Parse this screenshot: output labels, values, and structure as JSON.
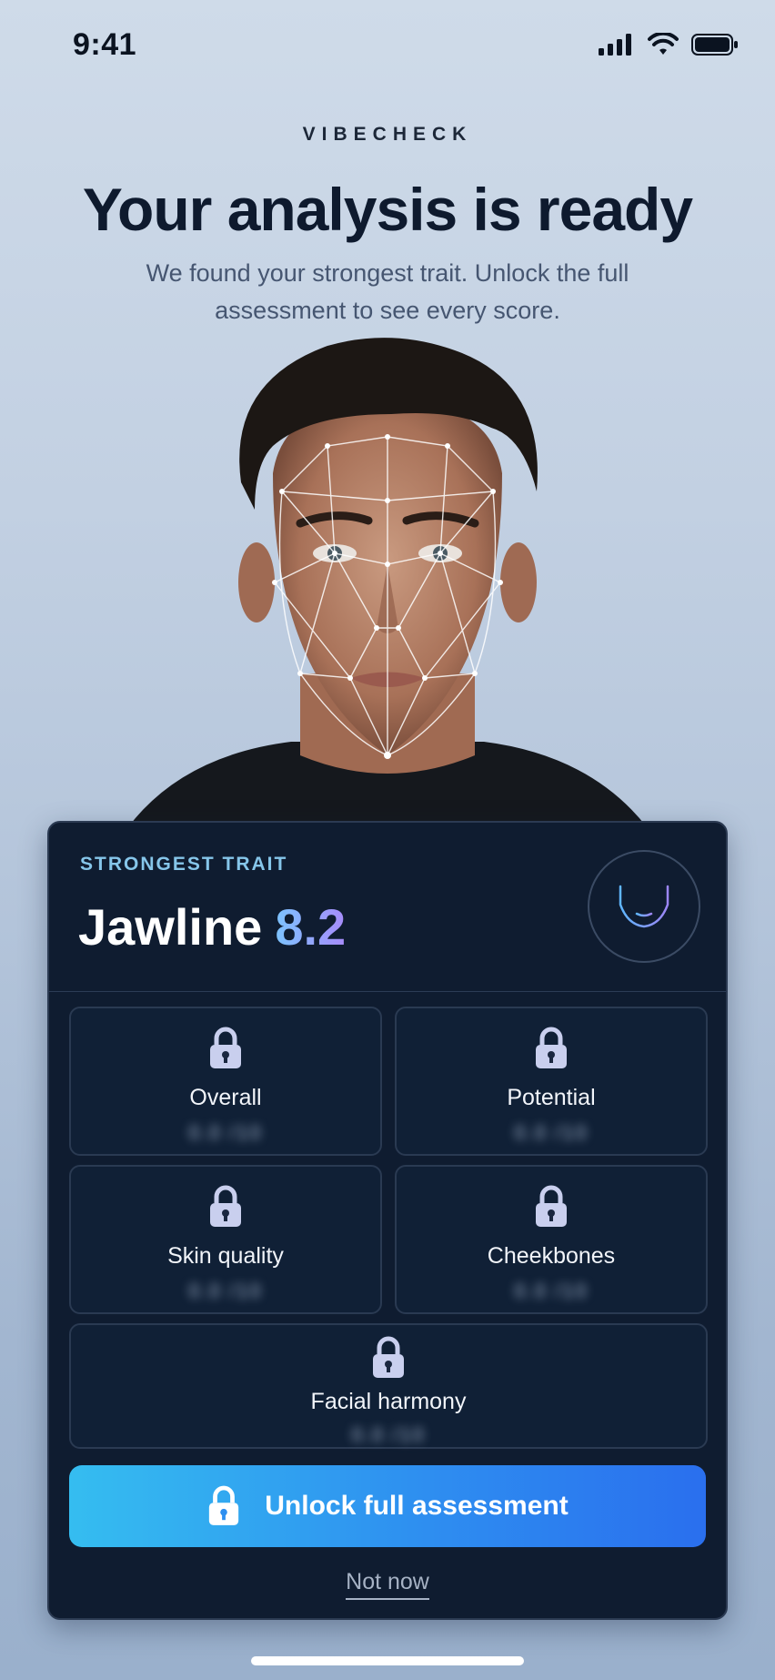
{
  "status_bar": {
    "time": "9:41",
    "signal_icon": "cellular-signal-icon",
    "wifi_icon": "wifi-icon",
    "battery_icon": "battery-icon"
  },
  "brand": "VIBECHECK",
  "headline": "Your analysis is ready",
  "subtitle": "We found your strongest trait. Unlock the full assessment to see every score.",
  "portrait": {
    "icon": "face-mesh-portrait"
  },
  "strongest": {
    "kicker": "STRONGEST TRAIT",
    "trait": "Jawline",
    "score": "8.2",
    "badge_icon": "jawline-icon"
  },
  "tiles": [
    {
      "label": "Overall",
      "value": "0.0 /10",
      "icon": "lock-icon"
    },
    {
      "label": "Potential",
      "value": "0.0 /10",
      "icon": "lock-icon"
    },
    {
      "label": "Skin quality",
      "value": "0.0 /10",
      "icon": "lock-icon"
    },
    {
      "label": "Cheekbones",
      "value": "0.0 /10",
      "icon": "lock-icon"
    },
    {
      "label": "Facial harmony",
      "value": "0.0 /10",
      "icon": "lock-icon"
    }
  ],
  "cta": {
    "label": "Unlock full assessment",
    "icon": "lock-icon"
  },
  "secondary": {
    "label": "Not now"
  },
  "colors": {
    "accent_start": "#35bdf0",
    "accent_end": "#2a6fee",
    "card_bg": "#0f1c30",
    "kicker": "#86c6ea",
    "score_start": "#7cc4ff",
    "score_end": "#a78bfa"
  }
}
